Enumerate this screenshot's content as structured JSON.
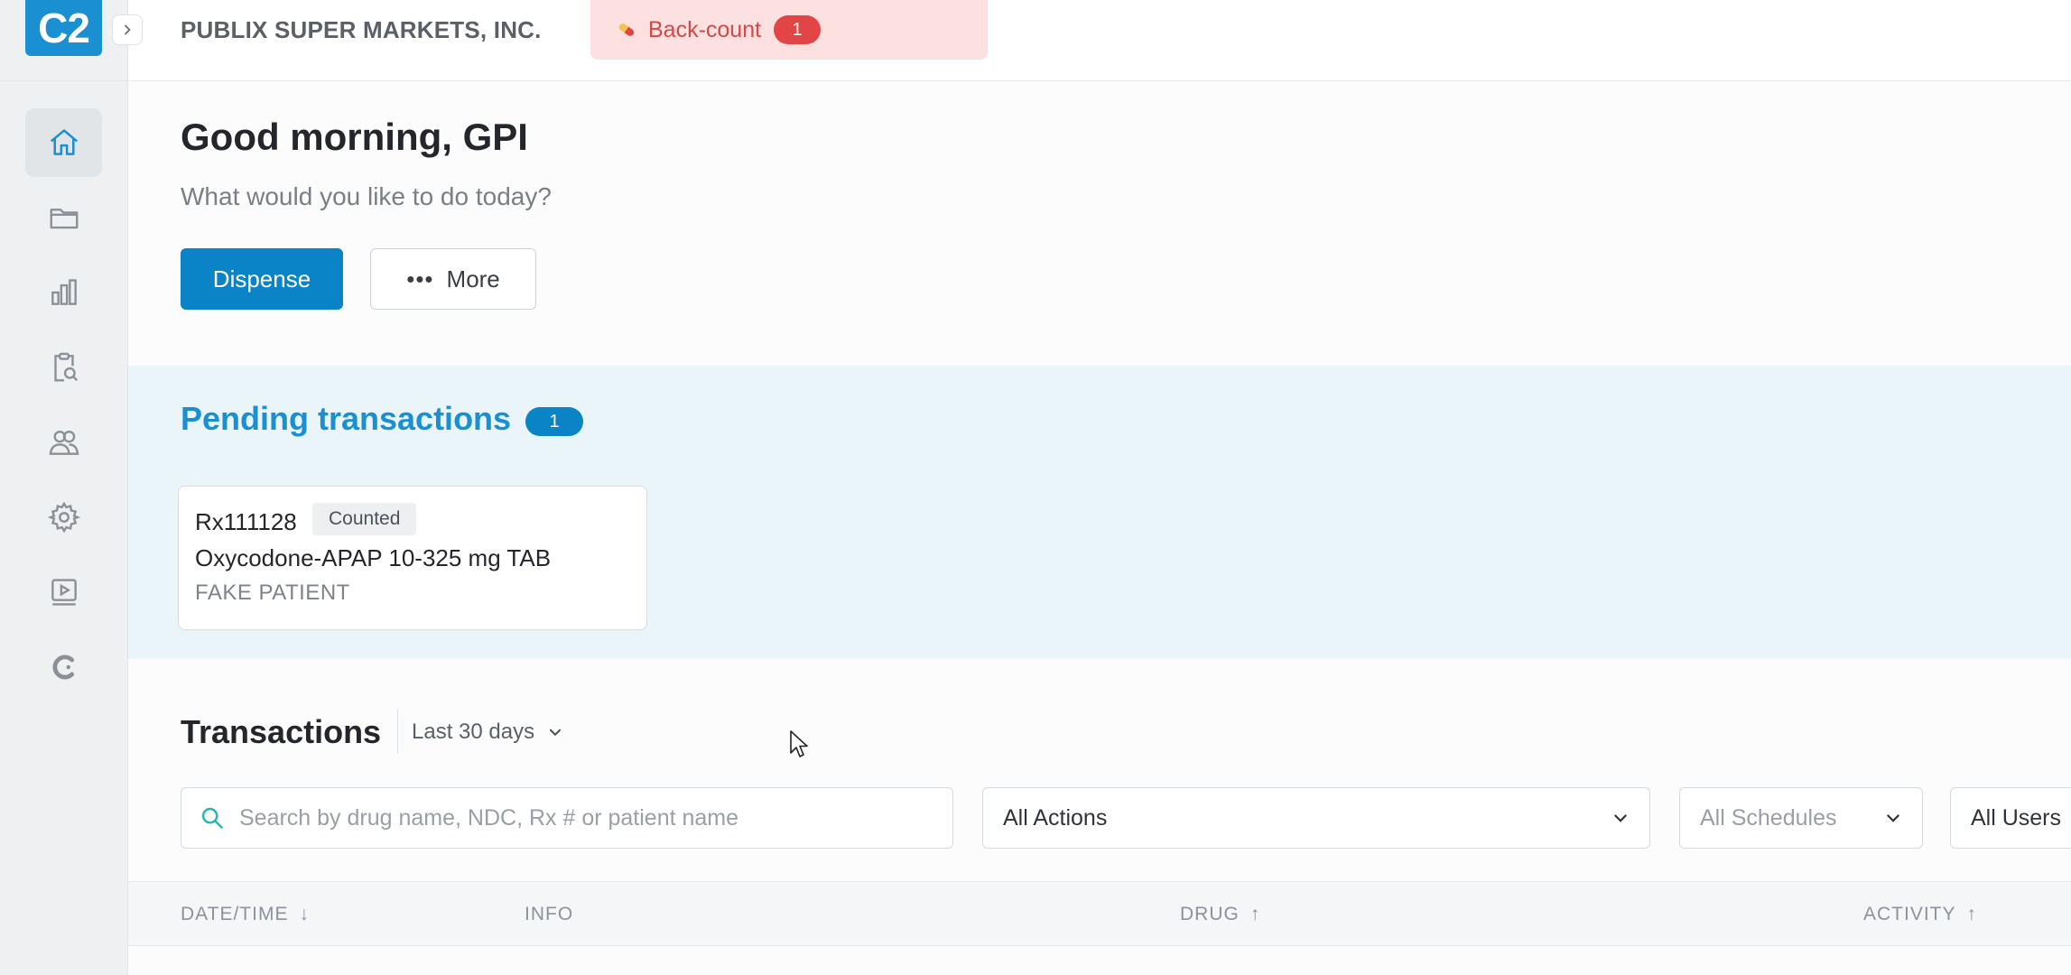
{
  "app": {
    "logo": "C2"
  },
  "header": {
    "company": "PUBLIX SUPER MARKETS, INC.",
    "backcount": {
      "label": "Back-count",
      "count": "1"
    }
  },
  "sidebar": {
    "items": [
      {
        "icon": "home-icon",
        "active": true
      },
      {
        "icon": "folder-icon"
      },
      {
        "icon": "bar-chart-icon"
      },
      {
        "icon": "clipboard-search-icon"
      },
      {
        "icon": "users-icon"
      },
      {
        "icon": "gear-icon"
      },
      {
        "icon": "video-player-icon"
      },
      {
        "icon": "c-logo-icon"
      }
    ]
  },
  "greeting": {
    "title": "Good morning, GPI",
    "subtitle": "What would you like to do today?",
    "primary_button": "Dispense",
    "more_button": "More"
  },
  "pending": {
    "title": "Pending transactions",
    "count": "1",
    "card": {
      "rx": "Rx111128",
      "status": "Counted",
      "drug": "Oxycodone-APAP 10-325 mg TAB",
      "patient": "FAKE PATIENT"
    }
  },
  "transactions": {
    "title": "Transactions",
    "range": "Last 30 days",
    "search_placeholder": "Search by drug name, NDC, Rx # or patient name",
    "filters": {
      "actions": "All Actions",
      "schedules": "All Schedules",
      "users": "All Users"
    },
    "columns": {
      "date": "DATE/TIME",
      "info": "INFO",
      "drug": "DRUG",
      "activity": "ACTIVITY"
    }
  },
  "colors": {
    "accent": "#0a84c6",
    "pending_bg": "#e9f5f9",
    "backcount_bg": "#fde0e0",
    "backcount_badge": "#e24545"
  }
}
